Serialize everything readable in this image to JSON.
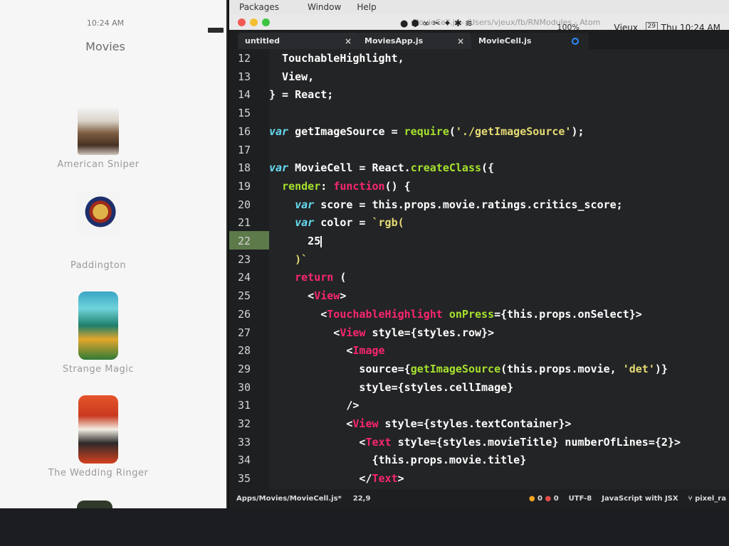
{
  "simulator": {
    "status_time": "10:24 AM",
    "title": "Movies",
    "movies": [
      {
        "title": "American Sniper"
      },
      {
        "title": "Paddington"
      },
      {
        "title": "Strange Magic"
      },
      {
        "title": "The Wedding Ringer"
      }
    ]
  },
  "menu": [
    "Packages",
    "Window",
    "Help"
  ],
  "system": {
    "battery": "100%",
    "user": "Vjeux",
    "date_badge": "29",
    "clock": "Thu 10:24 AM"
  },
  "window_title": "MovieCell.js - /Users/vjeux/fb/RNModules - Atom",
  "tabs": [
    {
      "label": "untitled"
    },
    {
      "label": "MoviesApp.js"
    },
    {
      "label": "MovieCell.js"
    }
  ],
  "code_lines": [
    {
      "n": "12",
      "html": "  TouchableHighlight,"
    },
    {
      "n": "13",
      "html": "  View,"
    },
    {
      "n": "14",
      "html": "} = React;"
    },
    {
      "n": "15",
      "html": ""
    },
    {
      "n": "16",
      "html": "var getImageSource = require('./getImageSource');"
    },
    {
      "n": "17",
      "html": ""
    },
    {
      "n": "18",
      "html": "var MovieCell = React.createClass({"
    },
    {
      "n": "19",
      "html": "  render: function() {"
    },
    {
      "n": "20",
      "html": "    var score = this.props.movie.ratings.critics_score;"
    },
    {
      "n": "21",
      "html": "    var color = `rgb("
    },
    {
      "n": "22",
      "html": "      25"
    },
    {
      "n": "23",
      "html": "    )`"
    },
    {
      "n": "24",
      "html": "    return ("
    },
    {
      "n": "25",
      "html": "      <View>"
    },
    {
      "n": "26",
      "html": "        <TouchableHighlight onPress={this.props.onSelect}>"
    },
    {
      "n": "27",
      "html": "          <View style={styles.row}>"
    },
    {
      "n": "28",
      "html": "            <Image"
    },
    {
      "n": "29",
      "html": "              source={getImageSource(this.props.movie, 'det')}"
    },
    {
      "n": "30",
      "html": "              style={styles.cellImage}"
    },
    {
      "n": "31",
      "html": "            />"
    },
    {
      "n": "32",
      "html": "            <View style={styles.textContainer}>"
    },
    {
      "n": "33",
      "html": "              <Text style={styles.movieTitle} numberOfLines={2}>"
    },
    {
      "n": "34",
      "html": "                {this.props.movie.title}"
    },
    {
      "n": "35",
      "html": "              </Text>"
    }
  ],
  "status": {
    "path": "Apps/Movies/MovieCell.js*",
    "position": "22,9",
    "warnings": "0",
    "errors": "0",
    "encoding": "UTF-8",
    "grammar": "JavaScript with JSX",
    "branch": "pixel_ra"
  }
}
